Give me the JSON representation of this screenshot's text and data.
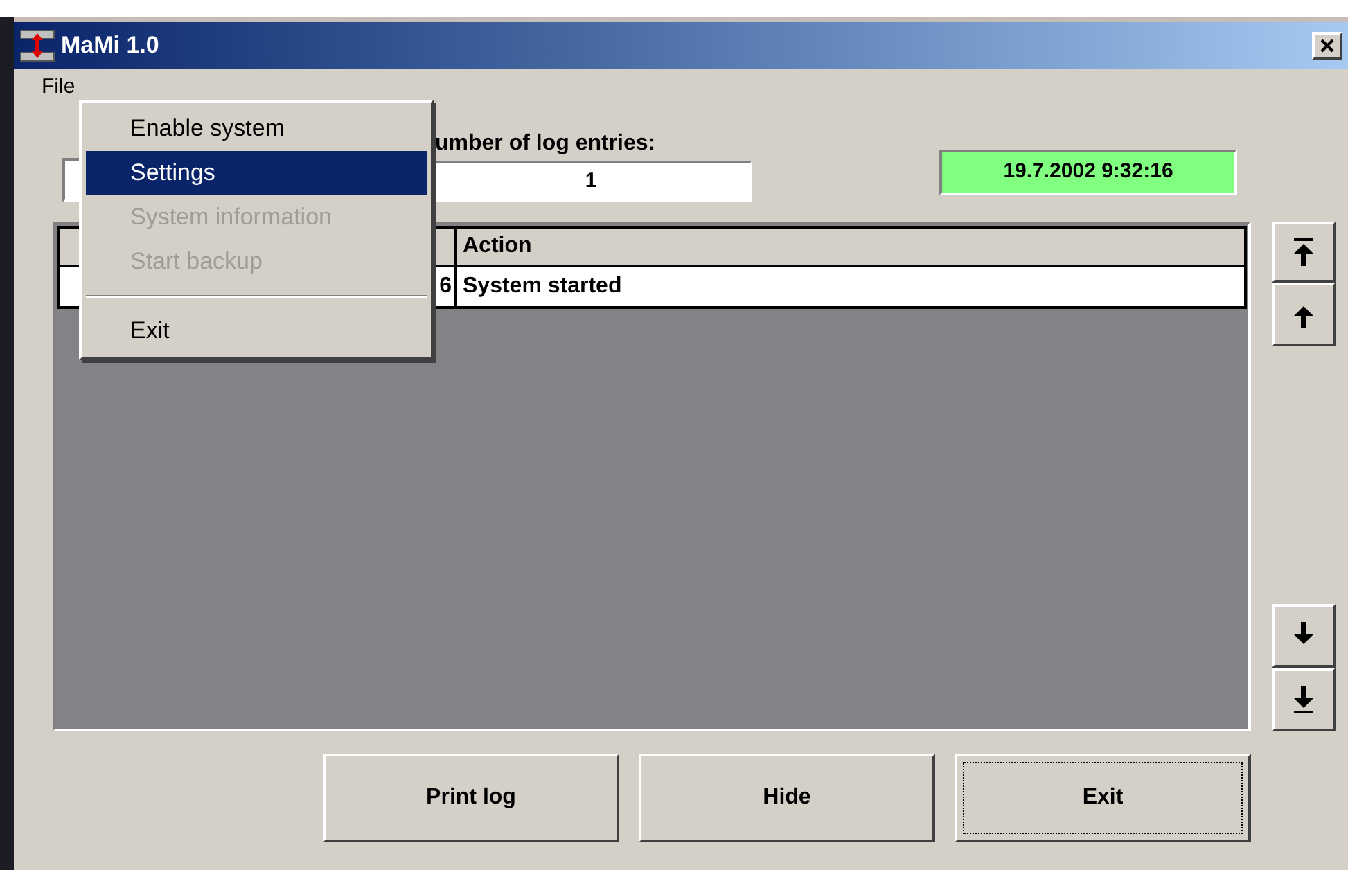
{
  "window": {
    "title": "MaMi 1.0"
  },
  "menu_bar": [
    "File"
  ],
  "open_menu": {
    "items": [
      {
        "label": "Enable system",
        "selected": false,
        "disabled": false
      },
      {
        "label": "Settings",
        "selected": true,
        "disabled": false
      },
      {
        "label": "System information",
        "selected": false,
        "disabled": true
      },
      {
        "label": "Start backup",
        "selected": false,
        "disabled": true
      },
      {
        "kind": "separator"
      },
      {
        "label": "Exit",
        "selected": false,
        "disabled": false
      }
    ]
  },
  "log_count": {
    "label": "umber of log entries:",
    "value": "1"
  },
  "clock": "19.7.2002 9:32:16",
  "table": {
    "column_3": "Action",
    "rows": [
      {
        "column_2": "6",
        "column_3": "System started"
      }
    ]
  },
  "buttons": [
    {
      "label": "Print log",
      "focused": false
    },
    {
      "label": "Hide",
      "focused": false
    },
    {
      "label": "Exit",
      "focused": true
    }
  ]
}
